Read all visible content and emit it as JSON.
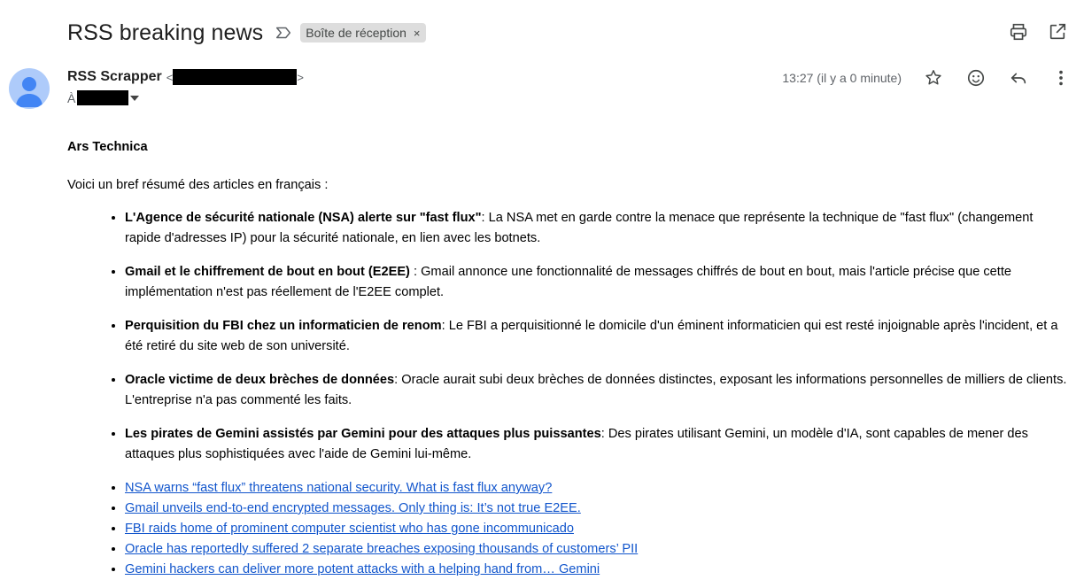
{
  "header": {
    "subject": "RSS breaking news",
    "label": "Boîte de réception",
    "label_close": "×",
    "icons": [
      "print-icon",
      "open-in-new-window-icon"
    ]
  },
  "sender": {
    "name": "RSS Scrapper",
    "email_open": "<",
    "email_close": ">",
    "to_label": "À",
    "time": "13:27 (il y a 0 minute)",
    "icons": [
      "star-icon",
      "emoji-reaction-icon",
      "reply-icon",
      "more-options-icon"
    ]
  },
  "body": {
    "source": "Ars Technica",
    "intro": "Voici un bref résumé des articles en français :",
    "summaries": [
      {
        "title": "L'Agence de sécurité nationale (NSA) alerte sur \"fast flux\"",
        "text": ": La NSA met en garde contre la menace que représente la technique de \"fast flux\" (changement rapide d'adresses IP) pour la sécurité nationale, en lien avec les botnets."
      },
      {
        "title": "Gmail et le chiffrement de bout en bout (E2EE)",
        "text": " : Gmail annonce une fonctionnalité de messages chiffrés de bout en bout, mais l'article précise que cette implémentation n'est pas réellement de l'E2EE complet."
      },
      {
        "title": "Perquisition du FBI chez un informaticien de renom",
        "text": ": Le FBI a perquisitionné le domicile d'un éminent informaticien qui est resté injoignable après l'incident, et a été retiré du site web de son université."
      },
      {
        "title": "Oracle victime de deux brèches de données",
        "text": ": Oracle aurait subi deux brèches de données distinctes, exposant les informations personnelles de milliers de clients. L'entreprise n'a pas commenté les faits."
      },
      {
        "title": "Les pirates de Gemini assistés par Gemini pour des attaques plus puissantes",
        "text": ": Des pirates utilisant Gemini, un modèle d'IA, sont capables de mener des attaques plus sophistiquées avec l'aide de Gemini lui-même."
      }
    ],
    "links": [
      "NSA warns “fast flux” threatens national security. What is fast flux anyway?",
      "Gmail unveils end-to-end encrypted messages. Only thing is: It’s not true E2EE.",
      "FBI raids home of prominent computer scientist who has gone incommunicado",
      "Oracle has reportedly suffered 2 separate breaches exposing thousands of customers’ PII",
      "Gemini hackers can deliver more potent attacks with a helping hand from… Gemini"
    ]
  }
}
